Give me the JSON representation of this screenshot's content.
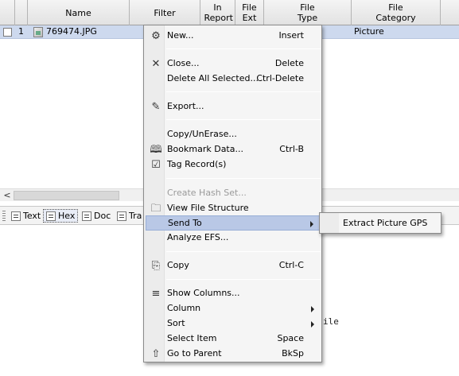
{
  "table": {
    "columns": [
      "Name",
      "Filter",
      "In Report",
      "File Ext",
      "File Type",
      "File Category"
    ],
    "row": {
      "number": "1",
      "name": "769474.JPG",
      "category": "Picture"
    }
  },
  "tabs": [
    {
      "label": "Text",
      "icon": "text-view-icon"
    },
    {
      "label": "Hex",
      "icon": "hex-view-icon"
    },
    {
      "label": "Doc",
      "icon": "doc-view-icon"
    },
    {
      "label": "Tra",
      "icon": "transcript-view-icon"
    }
  ],
  "background_text": "ile",
  "context_menu": {
    "items": [
      {
        "label": "New...",
        "shortcut": "Insert",
        "icon": "new-item-icon"
      },
      {
        "label": "Close...",
        "shortcut": "Delete",
        "icon": "close-icon"
      },
      {
        "label": "Delete All Selected...",
        "shortcut": "Ctrl-Delete"
      },
      {
        "label": "Export...",
        "shortcut": "",
        "icon": "export-icon"
      },
      {
        "label": "Copy/UnErase...",
        "shortcut": ""
      },
      {
        "label": "Bookmark Data...",
        "shortcut": "Ctrl-B",
        "icon": "bookmark-book-icon"
      },
      {
        "label": "Tag Record(s)",
        "shortcut": "",
        "icon": "tag-checkbox-icon"
      },
      {
        "label": "Create Hash Set...",
        "shortcut": "",
        "disabled": true
      },
      {
        "label": "View File Structure",
        "shortcut": "",
        "icon": "folder-icon"
      },
      {
        "label": "Send To",
        "shortcut": "",
        "submenu": true,
        "highlighted": true
      },
      {
        "label": "Analyze EFS...",
        "shortcut": ""
      },
      {
        "label": "Copy",
        "shortcut": "Ctrl-C",
        "icon": "copy-icon"
      },
      {
        "label": "Show Columns...",
        "shortcut": "",
        "icon": "columns-list-icon"
      },
      {
        "label": "Column",
        "shortcut": "",
        "submenu": true
      },
      {
        "label": "Sort",
        "shortcut": "",
        "submenu": true
      },
      {
        "label": "Select Item",
        "shortcut": "Space"
      },
      {
        "label": "Go to Parent",
        "shortcut": "BkSp",
        "icon": "go-to-parent-icon"
      }
    ]
  },
  "submenu": {
    "items": [
      {
        "label": "Extract Picture GPS"
      }
    ]
  }
}
